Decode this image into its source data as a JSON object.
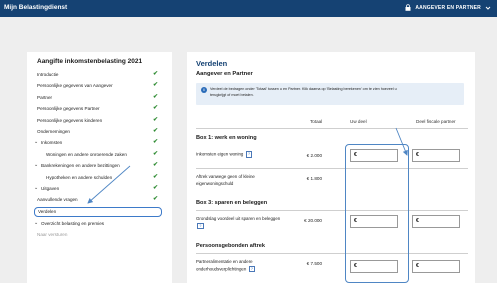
{
  "header": {
    "app_title": "Mijn Belastingdienst",
    "user_menu_label": "AANGEVER EN PARTNER",
    "bg_color": "#154273"
  },
  "sidebar": {
    "title": "Aangifte inkomstenbelasting 2021",
    "items": [
      {
        "label": "Introductie",
        "checked": true
      },
      {
        "label": "Persoonlijke gegevens van Aangever",
        "checked": true
      },
      {
        "label": "Partner",
        "checked": true
      },
      {
        "label": "Persoonlijke gegevens Partner",
        "checked": true
      },
      {
        "label": "Persoonlijke gegevens kinderen",
        "checked": true
      },
      {
        "label": "Ondernemingen",
        "checked": true
      },
      {
        "label": "Inkomsten",
        "checked": true,
        "expanded": true
      },
      {
        "label": "Woningen en andere onroerende zaken",
        "checked": true
      },
      {
        "label": "Bankrekeningen en andere bezittingen",
        "checked": true,
        "expanded": true
      },
      {
        "label": "Hypotheken en andere schulden",
        "checked": true
      },
      {
        "label": "Uitgaven",
        "checked": true,
        "expanded": true
      },
      {
        "label": "Aanvullende vragen",
        "checked": true
      },
      {
        "label": "Verdelen",
        "checked": false,
        "active": true
      },
      {
        "label": "Overzicht belasting en premies",
        "checked": false,
        "expanded": true
      },
      {
        "label": "Naar versturen",
        "checked": false,
        "muted": true
      }
    ],
    "check_symbol": "✔",
    "caret_symbol": "⌄"
  },
  "main": {
    "title": "Verdelen",
    "subtitle": "Aangever en Partner",
    "info_line1": "Verdeel de bedragen onder 'Totaal' tussen u en Partner. Klik daarna op 'Belasting berekenen' om te zien hoeveel u",
    "info_line2": "terugkrijgt of moet betalen.",
    "info_icon": "i",
    "col_total": "Totaal",
    "col_your_share": "Uw deel",
    "col_partner_share": "Deel fiscale partner",
    "sections": [
      {
        "title": "Box 1: werk en woning",
        "rows": [
          {
            "label": "Inkomsten eigen woning",
            "help": "?",
            "total": "€ 2.000",
            "input_you": "€",
            "input_partner": "€"
          },
          {
            "label": "Aftrek vanwege geen of kleine eigenwoningschuld",
            "help": "?",
            "total": "€ 1.800"
          }
        ]
      },
      {
        "title": "Box 3: sparen en beleggen",
        "rows": [
          {
            "label": "Grondslag voordeel uit sparen en beleggen",
            "help": "?",
            "total": "€ 20.000",
            "input_you": "€",
            "input_partner": "€"
          }
        ]
      },
      {
        "title": "Persoonsgebonden aftrek",
        "rows": [
          {
            "label": "Partneralimentatie en andere onderhoudsverplichtingen",
            "help": "?",
            "total": "€ 7.500",
            "input_you": "€",
            "input_partner": "€"
          }
        ]
      }
    ]
  },
  "colors": {
    "accent_blue": "#154273",
    "highlight_blue": "#4f86c4",
    "check_green": "#2e8b32",
    "info_bg": "#e6eef7"
  }
}
